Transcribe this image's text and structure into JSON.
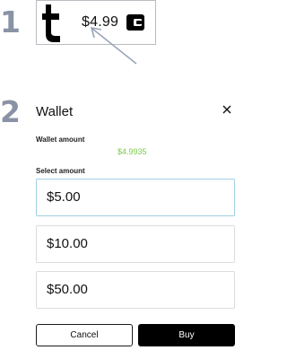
{
  "steps": [
    "1",
    "2"
  ],
  "header": {
    "balance": "$4.99",
    "logo_icon": "tumblr-t-logo",
    "wallet_icon": "wallet-icon",
    "annotation_icon": "arrow-icon"
  },
  "modal": {
    "title": "Wallet",
    "close_icon": "close-icon",
    "wallet_amount_label": "Wallet amount",
    "wallet_amount_value": "$4.9935",
    "select_amount_label": "Select amount",
    "options": [
      {
        "label": "$5.00",
        "selected": true
      },
      {
        "label": "$10.00",
        "selected": false
      },
      {
        "label": "$50.00",
        "selected": false
      }
    ],
    "cancel_label": "Cancel",
    "buy_label": "Buy"
  },
  "colors": {
    "step_number": "#8a93a6",
    "amount_green": "#7cc94a",
    "selected_border": "#9fd0e2",
    "primary_button": "#000000"
  }
}
